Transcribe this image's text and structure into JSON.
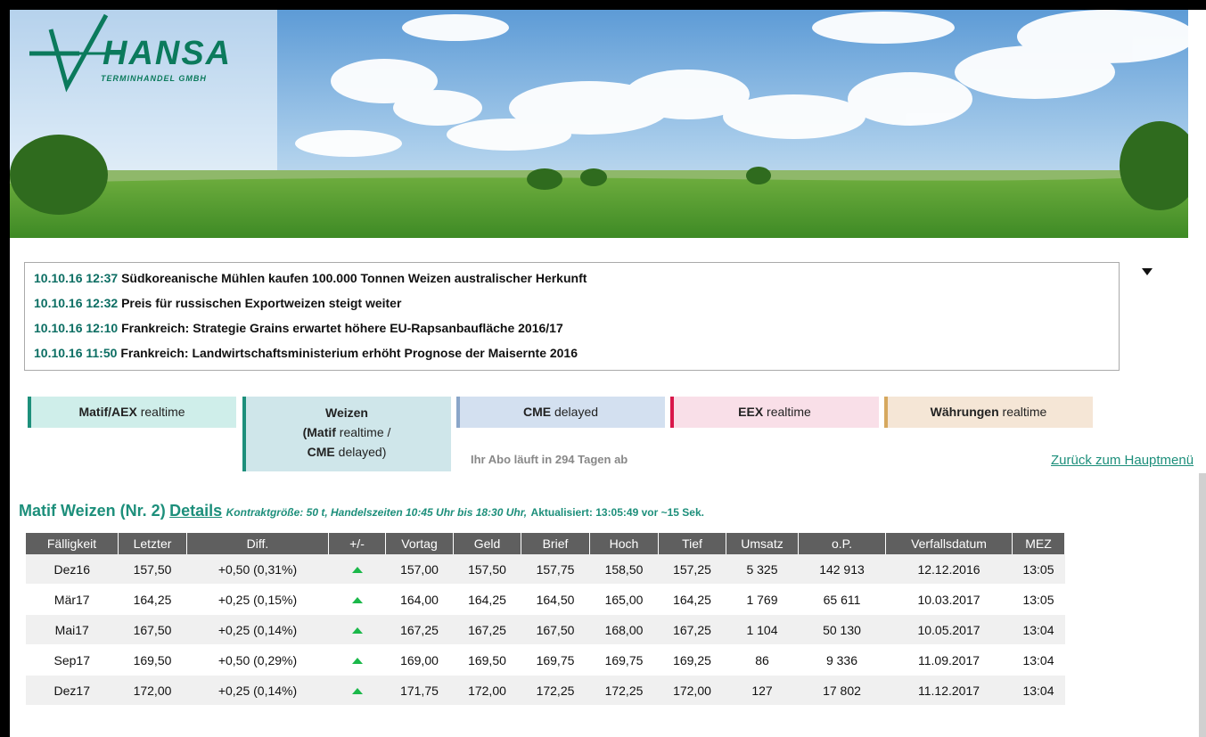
{
  "brand": {
    "logo_main": "HANSA",
    "logo_sub": "TERMINHANDEL GMBH"
  },
  "news": [
    {
      "time": "10.10.16 12:37",
      "text": "Südkoreanische Mühlen kaufen 100.000 Tonnen Weizen australischer Herkunft"
    },
    {
      "time": "10.10.16 12:32",
      "text": "Preis für russischen Exportweizen steigt weiter"
    },
    {
      "time": "10.10.16 12:10",
      "text": "Frankreich: Strategie Grains erwartet höhere EU-Rapsanbaufläche 2016/17"
    },
    {
      "time": "10.10.16 11:50",
      "text": "Frankreich: Landwirtschaftsministerium erhöht Prognose der Maisernte 2016"
    }
  ],
  "tabs": [
    {
      "name": "Matif/AEX",
      "suffix": " realtime"
    },
    {
      "name": "Weizen",
      "line2_bold": "(Matif",
      "line2": " realtime /",
      "line3_bold": "CME",
      "line3": " delayed)"
    },
    {
      "name": "CME",
      "suffix": " delayed"
    },
    {
      "name": "EEX",
      "suffix": " realtime"
    },
    {
      "name": "Währungen",
      "suffix": " realtime"
    }
  ],
  "abo_text": "Ihr Abo läuft in 294 Tagen ab",
  "back_link": "Zurück zum Hauptmenü",
  "heading": {
    "title": "Matif Weizen (Nr. 2)",
    "details": "Details",
    "meta": "Kontraktgröße: 50 t, Handelszeiten 10:45 Uhr bis 18:30 Uhr,",
    "updated": "Aktualisiert: 13:05:49 vor ~15 Sek."
  },
  "table": {
    "columns": [
      "Fälligkeit",
      "Letzter",
      "Diff.",
      "+/-",
      "Vortag",
      "Geld",
      "Brief",
      "Hoch",
      "Tief",
      "Umsatz",
      "o.P.",
      "Verfallsdatum",
      "MEZ"
    ],
    "rows": [
      [
        "Dez16",
        "157,50",
        "+0,50 (0,31%)",
        "up",
        "157,00",
        "157,50",
        "157,75",
        "158,50",
        "157,25",
        "5 325",
        "142 913",
        "12.12.2016",
        "13:05"
      ],
      [
        "Mär17",
        "164,25",
        "+0,25 (0,15%)",
        "up",
        "164,00",
        "164,25",
        "164,50",
        "165,00",
        "164,25",
        "1 769",
        "65 611",
        "10.03.2017",
        "13:05"
      ],
      [
        "Mai17",
        "167,50",
        "+0,25 (0,14%)",
        "up",
        "167,25",
        "167,25",
        "167,50",
        "168,00",
        "167,25",
        "1 104",
        "50 130",
        "10.05.2017",
        "13:04"
      ],
      [
        "Sep17",
        "169,50",
        "+0,50 (0,29%)",
        "up",
        "169,00",
        "169,50",
        "169,75",
        "169,75",
        "169,25",
        "86",
        "9 336",
        "11.09.2017",
        "13:04"
      ],
      [
        "Dez17",
        "172,00",
        "+0,25 (0,14%)",
        "up",
        "171,75",
        "172,00",
        "172,25",
        "172,25",
        "172,00",
        "127",
        "17 802",
        "11.12.2017",
        "13:04"
      ]
    ]
  },
  "colors": {
    "accent": "#1d8f7b",
    "up": "#1bb84a",
    "header_bg": "#5f5f5f"
  }
}
